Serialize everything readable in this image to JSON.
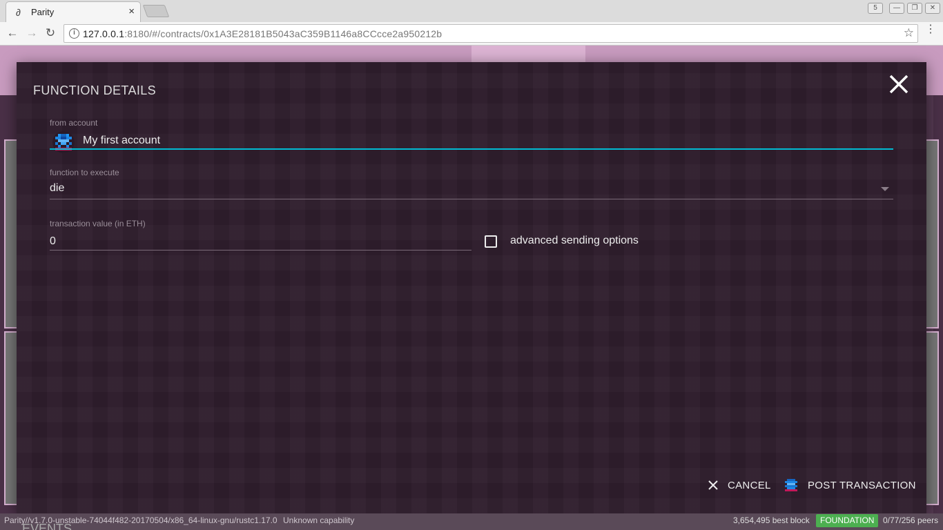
{
  "browser": {
    "tab_title": "Parity",
    "tab_close": "×",
    "url_host": "127.0.0.1",
    "url_rest": ":8180/#/contracts/0x1A3E28181B5043aC359B1146a8CCcce2a950212b",
    "info_icon_glyph": "i",
    "star_glyph": "☆",
    "back_glyph": "←",
    "forward_glyph": "→",
    "reload_glyph": "↻",
    "menu_glyph": "⋮",
    "ext_glyph": "5",
    "min_glyph": "—",
    "max_glyph": "❐",
    "close_glyph": "✕"
  },
  "modal": {
    "title": "FUNCTION DETAILS",
    "from_account_label": "from account",
    "from_account_value": "My first account",
    "function_label": "function to execute",
    "function_value": "die",
    "value_label": "transaction value (in ETH)",
    "value_value": "0",
    "advanced_label": "advanced sending options",
    "advanced_checked": false,
    "cancel_label": "CANCEL",
    "post_label": "POST TRANSACTION",
    "accent_color": "#00bcd4"
  },
  "status": {
    "version": "Parity//v1.7.0-unstable-74044f482-20170504/x86_64-linux-gnu/rustc1.17.0",
    "capability": "Unknown capability",
    "best_block": "3,654,495 best block",
    "network": "FOUNDATION",
    "peers": "0/77/256 peers",
    "network_color": "#4caf50"
  },
  "background": {
    "events_heading": "EVENTS"
  }
}
